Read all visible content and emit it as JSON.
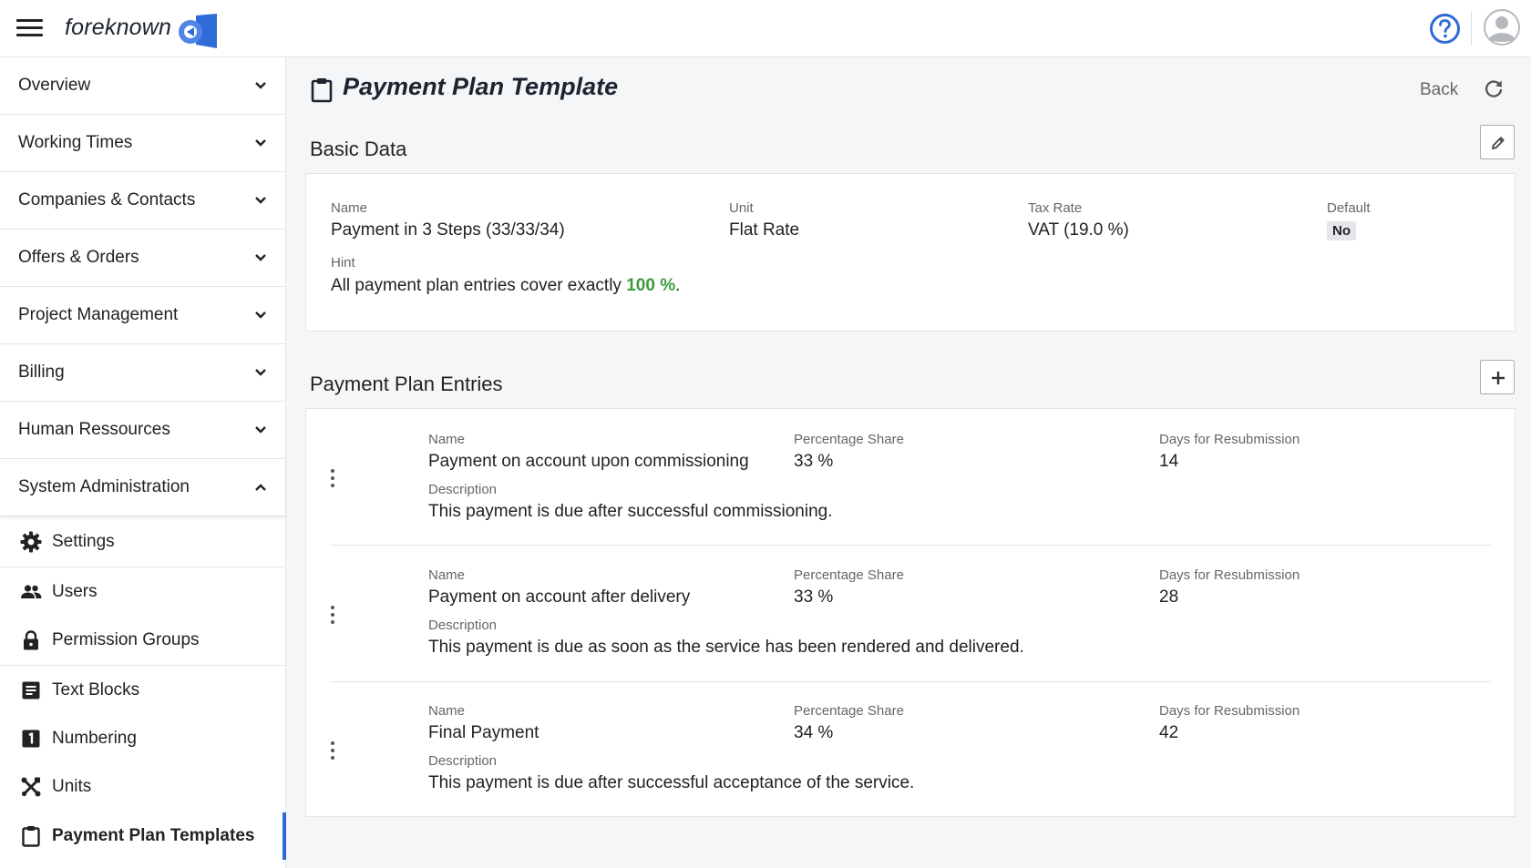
{
  "app": {
    "logo_text": "foreknown",
    "menu_icon": "hamburger-icon",
    "help_icon": "question-circle-icon",
    "avatar_icon": "user-avatar-icon",
    "accent_color": "#2f6bd7"
  },
  "sidebar": {
    "groups": [
      {
        "label": "Overview",
        "state": "collapsed"
      },
      {
        "label": "Working Times",
        "state": "collapsed"
      },
      {
        "label": "Companies & Contacts",
        "state": "collapsed"
      },
      {
        "label": "Offers & Orders",
        "state": "collapsed"
      },
      {
        "label": "Project Management",
        "state": "collapsed"
      },
      {
        "label": "Billing",
        "state": "collapsed"
      },
      {
        "label": "Human Ressources",
        "state": "collapsed"
      },
      {
        "label": "System Administration",
        "state": "expanded"
      }
    ],
    "items": [
      {
        "label": "Settings",
        "icon": "gear-icon"
      },
      {
        "label": "Users",
        "icon": "users-icon"
      },
      {
        "label": "Permission Groups",
        "icon": "lock-icon"
      },
      {
        "label": "Text Blocks",
        "icon": "text-document-icon"
      },
      {
        "label": "Numbering",
        "icon": "number-one-icon"
      },
      {
        "label": "Units",
        "icon": "tools-icon"
      },
      {
        "label": "Payment Plan Templates",
        "icon": "clipboard-icon",
        "active": true
      }
    ]
  },
  "page": {
    "title": "Payment Plan Template",
    "back_label": "Back"
  },
  "basic_data": {
    "title": "Basic Data",
    "name_label": "Name",
    "name_value": "Payment in 3 Steps (33/33/34)",
    "unit_label": "Unit",
    "unit_value": "Flat Rate",
    "tax_label": "Tax Rate",
    "tax_value": "VAT (19.0 %)",
    "default_label": "Default",
    "default_value": "No",
    "hint_label": "Hint",
    "hint_prefix": "All payment plan entries cover exactly",
    "hint_percent": "100 %",
    "hint_suffix": "."
  },
  "entries": {
    "title": "Payment Plan Entries",
    "name_label": "Name",
    "share_label": "Percentage Share",
    "days_label": "Days for Resubmission",
    "description_label": "Description",
    "rows": [
      {
        "name": "Payment on account upon commissioning",
        "share": "33 %",
        "days": "14",
        "description": "This payment is due after successful commissioning."
      },
      {
        "name": "Payment on account after delivery",
        "share": "33 %",
        "days": "28",
        "description": "This payment is due as soon as the service has been rendered and delivered."
      },
      {
        "name": "Final Payment",
        "share": "34 %",
        "days": "42",
        "description": "This payment is due after successful acceptance of the service."
      }
    ]
  }
}
